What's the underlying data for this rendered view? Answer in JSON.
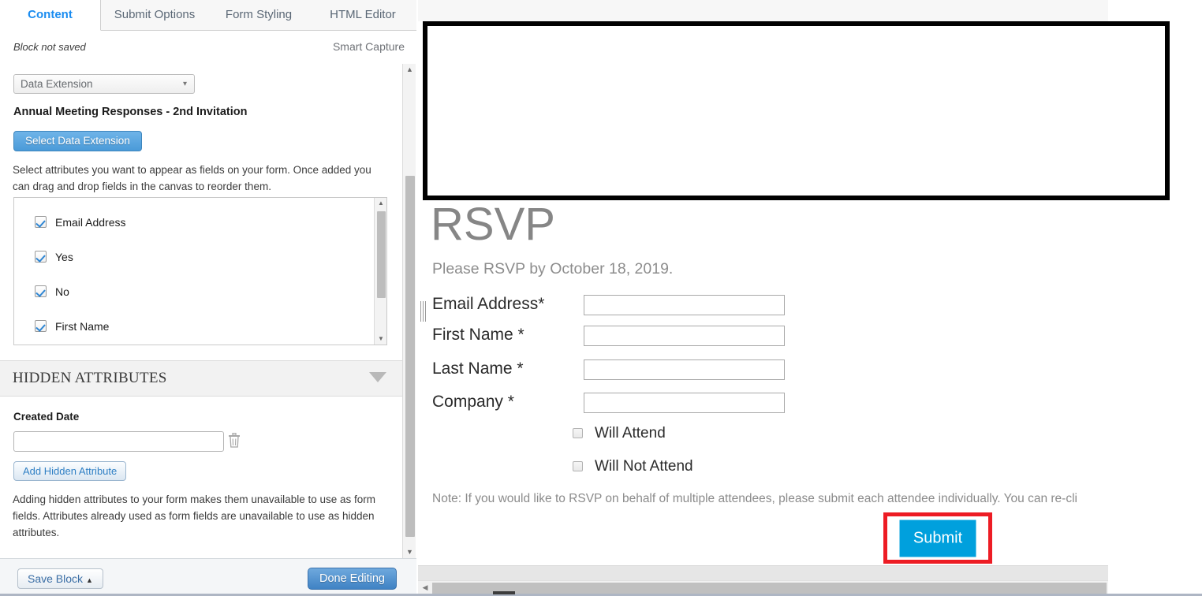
{
  "editor": {
    "tabs": [
      {
        "label": "Content",
        "active": true
      },
      {
        "label": "Submit Options",
        "active": false
      },
      {
        "label": "Form Styling",
        "active": false
      },
      {
        "label": "HTML Editor",
        "active": false
      }
    ],
    "block_status": "Block not saved",
    "smart_capture_label": "Smart Capture",
    "source_select": {
      "value": "Data Extension",
      "caret_icon": "chevron-down-icon"
    },
    "data_extension_name": "Annual Meeting Responses - 2nd Invitation",
    "select_de_button": "Select Data Extension",
    "attributes_helper": "Select attributes you want to appear as fields on your form. Once added you can drag and drop fields in the canvas to reorder them.",
    "attributes": [
      {
        "label": "Email Address",
        "checked": true
      },
      {
        "label": "Yes",
        "checked": true
      },
      {
        "label": "No",
        "checked": true
      },
      {
        "label": "First Name",
        "checked": true
      }
    ],
    "hidden_section": {
      "title": "HIDDEN ATTRIBUTES",
      "collapse_icon": "chevron-down-icon",
      "field_label": "Created Date",
      "field_value": "",
      "field_placeholder": "",
      "delete_icon": "trash-icon",
      "add_button": "Add Hidden Attribute",
      "helper": "Adding hidden attributes to your form makes them unavailable to use as form fields. Attributes already used as form fields are unavailable to use as hidden attributes."
    },
    "footer": {
      "save_block": "Save Block",
      "save_block_caret": "caret-up-icon",
      "done_editing": "Done Editing"
    },
    "scrollbar": {
      "up_icon": "caret-up-icon",
      "down_icon": "caret-down-icon"
    }
  },
  "preview": {
    "drag_handle_icon": "drag-handle-icon",
    "title": "RSVP",
    "subtitle": "Please RSVP by October 18, 2019.",
    "fields": [
      {
        "label": "Email Address*",
        "value": "",
        "placeholder": ""
      },
      {
        "label": "First Name *",
        "value": "",
        "placeholder": ""
      },
      {
        "label": "Last Name *",
        "value": "",
        "placeholder": ""
      },
      {
        "label": "Company *",
        "value": "",
        "placeholder": ""
      }
    ],
    "checkboxes": [
      {
        "label": "Will Attend",
        "checked": false
      },
      {
        "label": "Will Not Attend",
        "checked": false
      }
    ],
    "note": "Note: If you would like to RSVP on behalf of multiple attendees, please submit each attendee individually. You can re-cli",
    "submit_label": "Submit",
    "highlight_color": "#ed1c24",
    "submit_color": "#00a0dd",
    "h_scroll_left_icon": "caret-left-icon"
  }
}
